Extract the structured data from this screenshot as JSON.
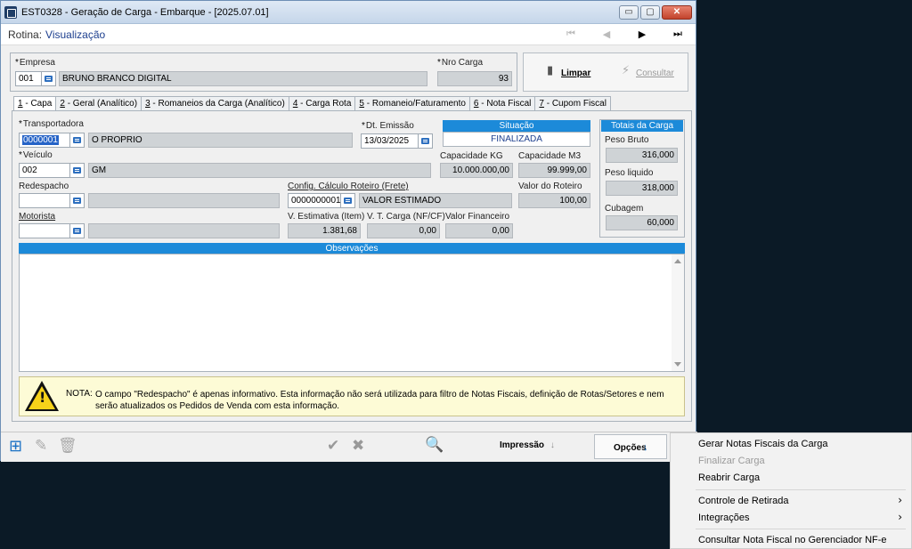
{
  "window": {
    "title": "EST0328 - Geração de Carga - Embarque - [2025.07.01]",
    "minimize": "▭",
    "maximize": "▢",
    "close": "✕"
  },
  "rotina": {
    "label": "Rotina:",
    "value": "Visualização"
  },
  "nav": {
    "first": "⏮",
    "prev": "◀",
    "next": "▶",
    "last": "⏭"
  },
  "header": {
    "empresa_label": "Empresa",
    "empresa_code": "001",
    "empresa_name": "BRUNO BRANCO DIGITAL",
    "nro_carga_label": "Nro Carga",
    "nro_carga": "93",
    "limpar_label": "Limpar",
    "consultar_label": "Consultar"
  },
  "tabs": [
    {
      "num": "1",
      "label": " - Capa"
    },
    {
      "num": "2",
      "label": " - Geral (Analítico)"
    },
    {
      "num": "3",
      "label": " - Romaneios da Carga (Analítico)"
    },
    {
      "num": "4",
      "label": " - Carga Rota"
    },
    {
      "num": "5",
      "label": " - Romaneio/Faturamento"
    },
    {
      "num": "6",
      "label": " - Nota Fiscal"
    },
    {
      "num": "7",
      "label": " - Cupom Fiscal"
    }
  ],
  "capa": {
    "transportadora_label": "Transportadora",
    "transportadora_code": "0000001",
    "transportadora_name": "O PROPRIO",
    "dt_emissao_label": "Dt. Emissão",
    "dt_emissao": "13/03/2025",
    "situacao_label": "Situação",
    "situacao": "FINALIZADA",
    "veiculo_label": "Veículo",
    "veiculo_code": "002",
    "veiculo_name": "GM",
    "capacidade_kg_label": "Capacidade KG",
    "capacidade_kg": "10.000.000,00",
    "capacidade_m3_label": "Capacidade M3",
    "capacidade_m3": "99.999,00",
    "redespacho_label": "Redespacho",
    "redespacho_code": "",
    "redespacho_name": "",
    "config_calc_label": "Config. Cálculo Roteiro (Frete)",
    "config_calc_code": "0000000001",
    "config_calc_name": "VALOR ESTIMADO",
    "valor_roteiro_label": "Valor do Roteiro",
    "valor_roteiro": "100,00",
    "motorista_label": "Motorista",
    "motorista_code": "",
    "motorista_name": "",
    "v_estimativa_label": "V. Estimativa (Item)",
    "v_estimativa": "1.381,68",
    "v_carga_label": "V. T. Carga (NF/CF)",
    "v_carga": "0,00",
    "valor_financeiro_label": "Valor Financeiro",
    "valor_financeiro": "0,00",
    "observacoes_label": "Observações"
  },
  "totais": {
    "title": "Totais da Carga",
    "peso_bruto_label": "Peso Bruto",
    "peso_bruto": "316,000",
    "peso_liquido_label": "Peso liquido",
    "peso_liquido": "318,000",
    "cubagem_label": "Cubagem",
    "cubagem": "60,000"
  },
  "note": {
    "label": "NOTA:",
    "text": "O campo \"Redespacho\" é apenas informativo. Esta informação não será utilizada para filtro de Notas Fiscais, definição de Rotas/Setores e nem serão atualizados os Pedidos de Venda com esta informação."
  },
  "bottom": {
    "impressao_label": "Impressão",
    "opcoes_label": "Opções"
  },
  "menu": {
    "items": [
      "Gerar Notas Fiscais da Carga",
      "Finalizar Carga",
      "Reabrir Carga",
      "Controle de Retirada",
      "Integrações",
      "Consultar Nota Fiscal no Gerenciador NF-e"
    ]
  },
  "colors": {
    "accent": "#1c8ad9",
    "readonly_field": "#cfd3d6",
    "note_bg": "#fdfbd6"
  }
}
